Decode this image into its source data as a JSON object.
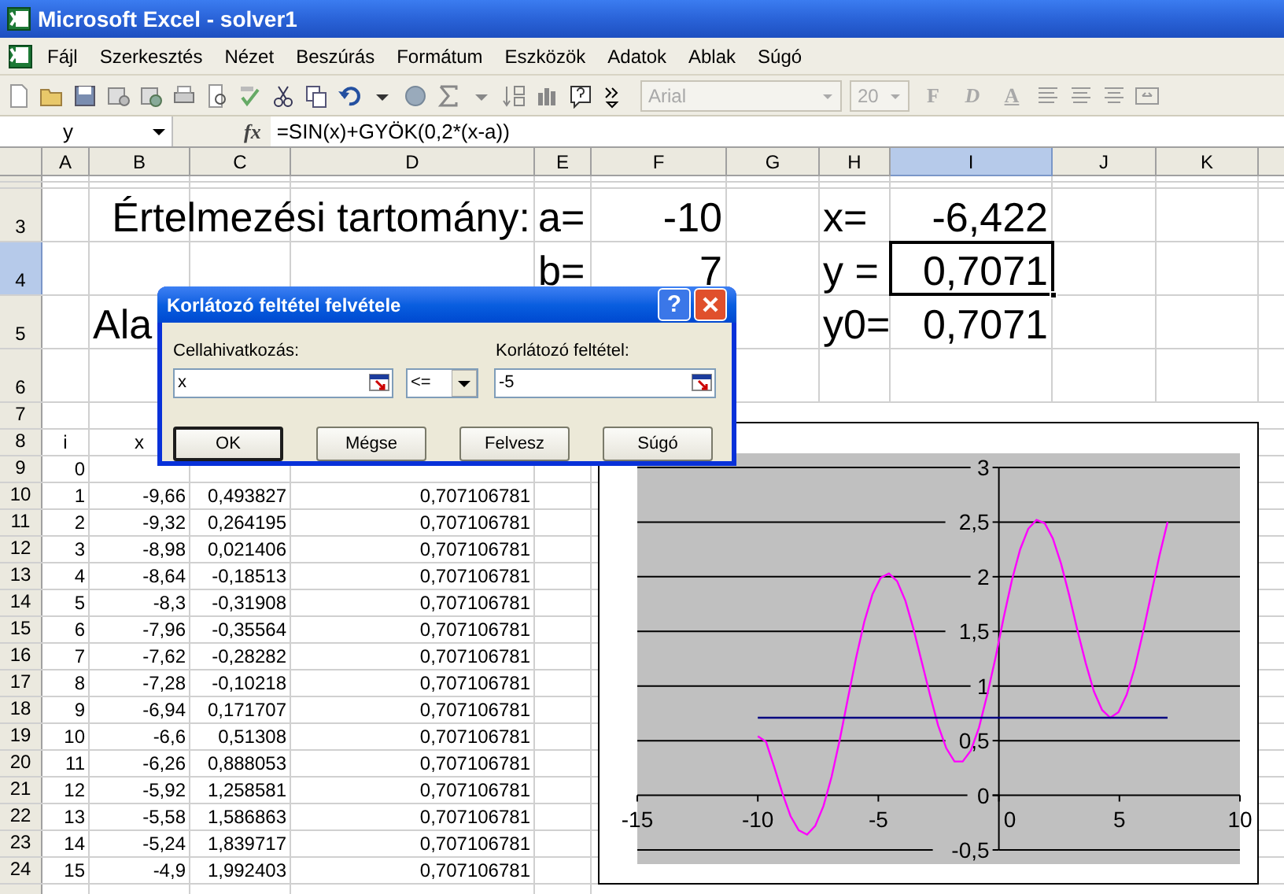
{
  "window": {
    "title": "Microsoft Excel - solver1"
  },
  "menu": [
    "Fájl",
    "Szerkesztés",
    "Nézet",
    "Beszúrás",
    "Formátum",
    "Eszközök",
    "Adatok",
    "Ablak",
    "Súgó"
  ],
  "toolbar": {
    "font_name": {
      "value": "Arial",
      "disabled": true
    },
    "font_size": {
      "value": "20",
      "disabled": true
    },
    "format_buttons": [
      {
        "label": "F",
        "kind": "bold",
        "disabled": true
      },
      {
        "label": "D",
        "kind": "italic",
        "disabled": true
      },
      {
        "label": "A",
        "kind": "underline",
        "disabled": true
      }
    ]
  },
  "formula_bar": {
    "name_box": "y",
    "fx": "fx",
    "formula": "=SIN(x)+GYÖK(0,2*(x-a))"
  },
  "columns": [
    {
      "label": "A",
      "selected": false
    },
    {
      "label": "B",
      "selected": false
    },
    {
      "label": "C",
      "selected": false
    },
    {
      "label": "D",
      "selected": false
    },
    {
      "label": "E",
      "selected": false
    },
    {
      "label": "F",
      "selected": false
    },
    {
      "label": "G",
      "selected": false
    },
    {
      "label": "H",
      "selected": false
    },
    {
      "label": "I",
      "selected": true
    },
    {
      "label": "J",
      "selected": false
    },
    {
      "label": "K",
      "selected": false
    }
  ],
  "rows": [
    {
      "label": "3",
      "selected": false,
      "kind": "big",
      "cells": {
        "D": "Értelmezési tartomány:",
        "E": "a=",
        "F": "-10",
        "H": "x=",
        "I": "-6,422"
      }
    },
    {
      "label": "4",
      "selected": true,
      "kind": "big",
      "cells": {
        "E": "b=",
        "F": "7",
        "H": "y =",
        "I": {
          "text": "0,7071",
          "active": true
        }
      }
    },
    {
      "label": "5",
      "selected": false,
      "kind": "big",
      "cells": {
        "B": "Ala",
        "H": "y0=",
        "I": "0,7071"
      }
    },
    {
      "label": "6",
      "selected": false,
      "kind": "big",
      "cells": {}
    },
    {
      "label": "7",
      "selected": false,
      "kind": "data",
      "cells": {}
    },
    {
      "label": "8",
      "selected": false,
      "kind": "header",
      "cells": {
        "A": "i",
        "B": "x"
      }
    },
    {
      "label": "9",
      "selected": false,
      "kind": "data",
      "cells": {
        "A": "0"
      }
    },
    {
      "label": "10",
      "selected": false,
      "kind": "data",
      "cells": {
        "A": "1",
        "B": "-9,66",
        "C": "0,493827",
        "D": "0,707106781"
      }
    },
    {
      "label": "11",
      "selected": false,
      "kind": "data",
      "cells": {
        "A": "2",
        "B": "-9,32",
        "C": "0,264195",
        "D": "0,707106781"
      }
    },
    {
      "label": "12",
      "selected": false,
      "kind": "data",
      "cells": {
        "A": "3",
        "B": "-8,98",
        "C": "0,021406",
        "D": "0,707106781"
      }
    },
    {
      "label": "13",
      "selected": false,
      "kind": "data",
      "cells": {
        "A": "4",
        "B": "-8,64",
        "C": "-0,18513",
        "D": "0,707106781"
      }
    },
    {
      "label": "14",
      "selected": false,
      "kind": "data",
      "cells": {
        "A": "5",
        "B": "-8,3",
        "C": "-0,31908",
        "D": "0,707106781"
      }
    },
    {
      "label": "15",
      "selected": false,
      "kind": "data",
      "cells": {
        "A": "6",
        "B": "-7,96",
        "C": "-0,35564",
        "D": "0,707106781"
      }
    },
    {
      "label": "16",
      "selected": false,
      "kind": "data",
      "cells": {
        "A": "7",
        "B": "-7,62",
        "C": "-0,28282",
        "D": "0,707106781"
      }
    },
    {
      "label": "17",
      "selected": false,
      "kind": "data",
      "cells": {
        "A": "8",
        "B": "-7,28",
        "C": "-0,10218",
        "D": "0,707106781"
      }
    },
    {
      "label": "18",
      "selected": false,
      "kind": "data",
      "cells": {
        "A": "9",
        "B": "-6,94",
        "C": "0,171707",
        "D": "0,707106781"
      }
    },
    {
      "label": "19",
      "selected": false,
      "kind": "data",
      "cells": {
        "A": "10",
        "B": "-6,6",
        "C": "0,51308",
        "D": "0,707106781"
      }
    },
    {
      "label": "20",
      "selected": false,
      "kind": "data",
      "cells": {
        "A": "11",
        "B": "-6,26",
        "C": "0,888053",
        "D": "0,707106781"
      }
    },
    {
      "label": "21",
      "selected": false,
      "kind": "data",
      "cells": {
        "A": "12",
        "B": "-5,92",
        "C": "1,258581",
        "D": "0,707106781"
      }
    },
    {
      "label": "22",
      "selected": false,
      "kind": "data",
      "cells": {
        "A": "13",
        "B": "-5,58",
        "C": "1,586863",
        "D": "0,707106781"
      }
    },
    {
      "label": "23",
      "selected": false,
      "kind": "data",
      "cells": {
        "A": "14",
        "B": "-5,24",
        "C": "1,839717",
        "D": "0,707106781"
      }
    },
    {
      "label": "24",
      "selected": false,
      "kind": "data",
      "cells": {
        "A": "15",
        "B": "-4,9",
        "C": "1,992403",
        "D": "0,707106781"
      }
    }
  ],
  "chart": {
    "chart_data": {
      "type": "line",
      "grid": true,
      "xlim": [
        -15,
        10
      ],
      "ylim": [
        -0.5,
        3
      ],
      "xticks": [
        {
          "value": -15,
          "label": "-15"
        },
        {
          "value": -10,
          "label": "-10"
        },
        {
          "value": -5,
          "label": "-5"
        },
        {
          "value": 0,
          "label": "0"
        },
        {
          "value": 5,
          "label": "5"
        },
        {
          "value": 10,
          "label": "10"
        }
      ],
      "yticks": [
        {
          "value": -0.5,
          "label": "-0,5"
        },
        {
          "value": 0,
          "label": "0"
        },
        {
          "value": 0.5,
          "label": "0,5"
        },
        {
          "value": 1,
          "label": "1"
        },
        {
          "value": 1.5,
          "label": "1,5"
        },
        {
          "value": 2,
          "label": "2"
        },
        {
          "value": 2.5,
          "label": "2,5"
        },
        {
          "value": 3,
          "label": "3"
        }
      ],
      "x": [
        -10,
        -9.66,
        -9.32,
        -8.98,
        -8.64,
        -8.3,
        -7.96,
        -7.62,
        -7.28,
        -6.94,
        -6.6,
        -6.26,
        -5.92,
        -5.58,
        -5.24,
        -4.9,
        -4.56,
        -4.22,
        -3.88,
        -3.54,
        -3.2,
        -2.86,
        -2.52,
        -2.18,
        -1.84,
        -1.5,
        -1.16,
        -0.82,
        -0.48,
        -0.14,
        0.2,
        0.54,
        0.88,
        1.22,
        1.56,
        1.9,
        2.24,
        2.58,
        2.92,
        3.26,
        3.6,
        3.94,
        4.28,
        4.62,
        4.96,
        5.3,
        5.64,
        5.98,
        6.32,
        6.66,
        7
      ],
      "series": [
        {
          "color": "#ff00ff",
          "values": [
            0.54,
            0.49,
            0.26,
            0.02,
            -0.19,
            -0.32,
            -0.36,
            -0.28,
            -0.1,
            0.17,
            0.51,
            0.89,
            1.26,
            1.59,
            1.84,
            1.99,
            2.03,
            1.96,
            1.78,
            1.52,
            1.22,
            0.92,
            0.64,
            0.43,
            0.31,
            0.31,
            0.41,
            0.62,
            0.92,
            1.26,
            1.63,
            1.97,
            2.25,
            2.44,
            2.52,
            2.49,
            2.35,
            2.12,
            1.83,
            1.51,
            1.21,
            0.95,
            0.78,
            0.71,
            0.76,
            0.92,
            1.17,
            1.49,
            1.84,
            2.19,
            2.5
          ]
        },
        {
          "color": "#000080",
          "values": [
            0.71,
            0.71,
            0.71,
            0.71,
            0.71,
            0.71,
            0.71,
            0.71,
            0.71,
            0.71,
            0.71,
            0.71,
            0.71,
            0.71,
            0.71,
            0.71,
            0.71,
            0.71,
            0.71,
            0.71,
            0.71,
            0.71,
            0.71,
            0.71,
            0.71,
            0.71,
            0.71,
            0.71,
            0.71,
            0.71,
            0.71,
            0.71,
            0.71,
            0.71,
            0.71,
            0.71,
            0.71,
            0.71,
            0.71,
            0.71,
            0.71,
            0.71,
            0.71,
            0.71,
            0.71,
            0.71,
            0.71,
            0.71,
            0.71,
            0.71,
            0.71
          ]
        }
      ]
    }
  },
  "dialog": {
    "title": "Korlátozó feltétel felvétele",
    "help_button": "?",
    "cell_reference": {
      "label": "Cellahivatkozás:",
      "value": "x"
    },
    "operator": "<=",
    "constraint": {
      "label": "Korlátozó feltétel:",
      "value": "-5"
    },
    "buttons": [
      {
        "label": "OK",
        "selected": true
      },
      {
        "label": "Mégse",
        "selected": false
      },
      {
        "label": "Felvesz",
        "selected": false
      },
      {
        "label": "Súgó",
        "selected": false
      }
    ]
  }
}
